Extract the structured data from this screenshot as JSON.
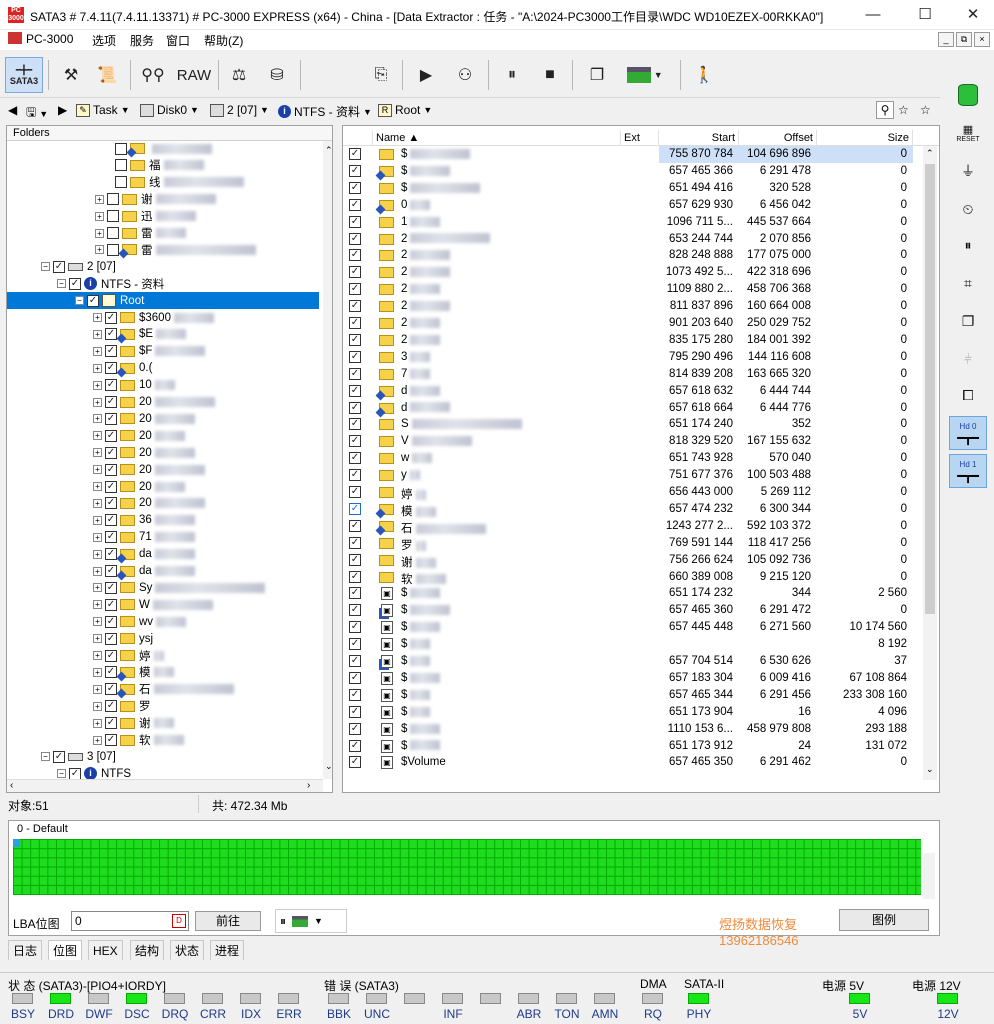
{
  "window": {
    "title": "SATA3 # 7.4.11(7.4.11.13371) # PC-3000 EXPRESS (x64) - China - [Data Extractor : 任务 - \"A:\\2024-PC3000工作目录\\WDC WD10EZEX-00RKKA0\"]",
    "minimize": "—",
    "maximize": "☐",
    "close": "✕"
  },
  "menu": {
    "items": [
      "PC-3000",
      "选项",
      "服务",
      "窗口",
      "帮助(Z)"
    ],
    "mdi": [
      "_",
      "⧉",
      "×"
    ]
  },
  "toolbar": {
    "sata_label": "SATA3",
    "raw_label": "RAW"
  },
  "nav": {
    "task": "Task",
    "disk": "Disk0",
    "partition": "2 [07]",
    "fs": "NTFS - 资料",
    "root": "Root"
  },
  "folders": {
    "header": "Folders",
    "rows": [
      {
        "label": "",
        "indent": 108,
        "blur": 60,
        "plus": false,
        "check": "",
        "type": "net"
      },
      {
        "label": "福",
        "indent": 108,
        "blur": 40,
        "plus": false,
        "check": "",
        "type": "folder"
      },
      {
        "label": "线",
        "indent": 108,
        "blur": 80,
        "plus": false,
        "check": "",
        "type": "folder"
      },
      {
        "label": "谢",
        "indent": 100,
        "blur": 60,
        "plus": true,
        "check": "",
        "type": "folder"
      },
      {
        "label": "迅",
        "indent": 100,
        "blur": 40,
        "plus": true,
        "check": "",
        "type": "folder"
      },
      {
        "label": "雷",
        "indent": 100,
        "blur": 30,
        "plus": true,
        "check": "",
        "type": "folder"
      },
      {
        "label": "雷",
        "indent": 100,
        "blur": 100,
        "plus": true,
        "check": "",
        "type": "net"
      },
      {
        "label": "2 [07]",
        "indent": 46,
        "blur": 0,
        "plus": true,
        "check": "✓",
        "type": "disk"
      },
      {
        "label": "NTFS - 资料",
        "indent": 62,
        "blur": 0,
        "plus": true,
        "check": "✓",
        "type": "info"
      },
      {
        "label": "Root",
        "indent": 80,
        "blur": 0,
        "plus": true,
        "check": "✓",
        "type": "root",
        "selected": true
      },
      {
        "label": "$3600",
        "indent": 98,
        "blur": 40,
        "plus": true,
        "check": "✓",
        "type": "folder"
      },
      {
        "label": "$E",
        "indent": 98,
        "blur": 30,
        "plus": true,
        "check": "✓",
        "type": "net"
      },
      {
        "label": "$F",
        "indent": 98,
        "blur": 50,
        "plus": true,
        "check": "✓",
        "type": "folder"
      },
      {
        "label": "0.(",
        "indent": 98,
        "blur": 0,
        "plus": true,
        "check": "✓",
        "type": "net"
      },
      {
        "label": "10",
        "indent": 98,
        "blur": 20,
        "plus": true,
        "check": "✓",
        "type": "folder"
      },
      {
        "label": "20",
        "indent": 98,
        "blur": 60,
        "plus": true,
        "check": "✓",
        "type": "folder"
      },
      {
        "label": "20",
        "indent": 98,
        "blur": 40,
        "plus": true,
        "check": "✓",
        "type": "folder"
      },
      {
        "label": "20",
        "indent": 98,
        "blur": 30,
        "plus": true,
        "check": "✓",
        "type": "folder"
      },
      {
        "label": "20",
        "indent": 98,
        "blur": 40,
        "plus": true,
        "check": "✓",
        "type": "folder"
      },
      {
        "label": "20",
        "indent": 98,
        "blur": 50,
        "plus": true,
        "check": "✓",
        "type": "folder"
      },
      {
        "label": "20",
        "indent": 98,
        "blur": 30,
        "plus": true,
        "check": "✓",
        "type": "folder"
      },
      {
        "label": "20",
        "indent": 98,
        "blur": 50,
        "plus": true,
        "check": "✓",
        "type": "folder"
      },
      {
        "label": "36",
        "indent": 98,
        "blur": 40,
        "plus": true,
        "check": "✓",
        "type": "folder"
      },
      {
        "label": "71",
        "indent": 98,
        "blur": 40,
        "plus": true,
        "check": "✓",
        "type": "folder"
      },
      {
        "label": "da",
        "indent": 98,
        "blur": 40,
        "plus": true,
        "check": "✓",
        "type": "net"
      },
      {
        "label": "da",
        "indent": 98,
        "blur": 40,
        "plus": true,
        "check": "✓",
        "type": "net"
      },
      {
        "label": "Sy",
        "indent": 98,
        "blur": 110,
        "plus": true,
        "check": "✓",
        "type": "folder"
      },
      {
        "label": "W",
        "indent": 98,
        "blur": 60,
        "plus": true,
        "check": "✓",
        "type": "folder"
      },
      {
        "label": "wv",
        "indent": 98,
        "blur": 30,
        "plus": true,
        "check": "✓",
        "type": "folder"
      },
      {
        "label": "ysj",
        "indent": 98,
        "blur": 0,
        "plus": true,
        "check": "✓",
        "type": "folder"
      },
      {
        "label": "婷",
        "indent": 98,
        "blur": 10,
        "plus": true,
        "check": "✓",
        "type": "folder"
      },
      {
        "label": "模",
        "indent": 98,
        "blur": 20,
        "plus": true,
        "check": "✓",
        "type": "net"
      },
      {
        "label": "石",
        "indent": 98,
        "blur": 80,
        "plus": true,
        "check": "✓",
        "type": "net"
      },
      {
        "label": "罗",
        "indent": 98,
        "blur": 0,
        "plus": true,
        "check": "✓",
        "type": "folder"
      },
      {
        "label": "谢",
        "indent": 98,
        "blur": 20,
        "plus": true,
        "check": "✓",
        "type": "folder"
      },
      {
        "label": "软",
        "indent": 98,
        "blur": 30,
        "plus": true,
        "check": "✓",
        "type": "folder"
      },
      {
        "label": "3 [07]",
        "indent": 46,
        "blur": 0,
        "plus": true,
        "check": "✓",
        "type": "disk"
      },
      {
        "label": "NTFS",
        "indent": 62,
        "blur": 0,
        "plus": true,
        "check": "✓",
        "type": "info"
      },
      {
        "label": "Root",
        "indent": 80,
        "blur": 0,
        "plus": true,
        "check": "✓",
        "type": "root"
      }
    ]
  },
  "files": {
    "columns": [
      "Name ▲",
      "Ext",
      "Start",
      "Offset",
      "Size"
    ],
    "rows": [
      {
        "name": "$",
        "blur": 60,
        "start": "755 870 784",
        "offset": "104 696 896",
        "size": "0",
        "type": "folder",
        "hl": true
      },
      {
        "name": "$",
        "blur": 40,
        "start": "657 465 366",
        "offset": "6 291 478",
        "size": "0",
        "type": "net"
      },
      {
        "name": "$",
        "blur": 70,
        "start": "651 494 416",
        "offset": "320 528",
        "size": "0",
        "type": "folder"
      },
      {
        "name": "0",
        "blur": 20,
        "start": "657 629 930",
        "offset": "6 456 042",
        "size": "0",
        "type": "net"
      },
      {
        "name": "1",
        "blur": 30,
        "start": "1096 711 5...",
        "offset": "445 537 664",
        "size": "0",
        "type": "folder"
      },
      {
        "name": "2",
        "blur": 80,
        "start": "653 244 744",
        "offset": "2 070 856",
        "size": "0",
        "type": "folder"
      },
      {
        "name": "2",
        "blur": 40,
        "start": "828 248 888",
        "offset": "177 075 000",
        "size": "0",
        "type": "folder"
      },
      {
        "name": "2",
        "blur": 40,
        "start": "1073 492 5...",
        "offset": "422 318 696",
        "size": "0",
        "type": "folder"
      },
      {
        "name": "2",
        "blur": 30,
        "start": "1109 880 2...",
        "offset": "458 706 368",
        "size": "0",
        "type": "folder"
      },
      {
        "name": "2",
        "blur": 40,
        "start": "811 837 896",
        "offset": "160 664 008",
        "size": "0",
        "type": "folder"
      },
      {
        "name": "2",
        "blur": 30,
        "start": "901 203 640",
        "offset": "250 029 752",
        "size": "0",
        "type": "folder"
      },
      {
        "name": "2",
        "blur": 30,
        "start": "835 175 280",
        "offset": "184 001 392",
        "size": "0",
        "type": "folder"
      },
      {
        "name": "3",
        "blur": 20,
        "start": "795 290 496",
        "offset": "144 116 608",
        "size": "0",
        "type": "folder"
      },
      {
        "name": "7",
        "blur": 20,
        "start": "814 839 208",
        "offset": "163 665 320",
        "size": "0",
        "type": "folder"
      },
      {
        "name": "d",
        "blur": 30,
        "start": "657 618 632",
        "offset": "6 444 744",
        "size": "0",
        "type": "net"
      },
      {
        "name": "d",
        "blur": 40,
        "start": "657 618 664",
        "offset": "6 444 776",
        "size": "0",
        "type": "net"
      },
      {
        "name": "S",
        "blur": 110,
        "start": "651 174 240",
        "offset": "352",
        "size": "0",
        "type": "folder"
      },
      {
        "name": "V",
        "blur": 60,
        "start": "818 329 520",
        "offset": "167 155 632",
        "size": "0",
        "type": "folder"
      },
      {
        "name": "w",
        "blur": 20,
        "start": "651 743 928",
        "offset": "570 040",
        "size": "0",
        "type": "folder"
      },
      {
        "name": "y",
        "blur": 10,
        "start": "751 677 376",
        "offset": "100 503 488",
        "size": "0",
        "type": "folder"
      },
      {
        "name": "婷",
        "blur": 10,
        "start": "656 443 000",
        "offset": "5 269 112",
        "size": "0",
        "type": "folder"
      },
      {
        "name": "模",
        "blur": 20,
        "start": "657 474 232",
        "offset": "6 300 344",
        "size": "0",
        "type": "net",
        "check": "blue"
      },
      {
        "name": "石",
        "blur": 70,
        "start": "1243 277 2...",
        "offset": "592 103 372",
        "size": "0",
        "type": "net"
      },
      {
        "name": "罗",
        "blur": 10,
        "start": "769 591 144",
        "offset": "118 417 256",
        "size": "0",
        "type": "folder"
      },
      {
        "name": "谢",
        "blur": 20,
        "start": "756 266 624",
        "offset": "105 092 736",
        "size": "0",
        "type": "folder"
      },
      {
        "name": "软",
        "blur": 30,
        "start": "660 389 008",
        "offset": "9 215 120",
        "size": "0",
        "type": "folder"
      },
      {
        "name": "$",
        "blur": 30,
        "start": "651 174 232",
        "offset": "344",
        "size": "2 560",
        "type": "file"
      },
      {
        "name": "$",
        "blur": 40,
        "start": "657 465 360",
        "offset": "6 291 472",
        "size": "0",
        "type": "netfile"
      },
      {
        "name": "$",
        "blur": 30,
        "start": "657 445 448",
        "offset": "6 271 560",
        "size": "10 174 560",
        "type": "file"
      },
      {
        "name": "$",
        "blur": 20,
        "start": "",
        "offset": "",
        "size": "8 192",
        "type": "file"
      },
      {
        "name": "$",
        "blur": 20,
        "start": "657 704 514",
        "offset": "6 530 626",
        "size": "37",
        "type": "netfile"
      },
      {
        "name": "$",
        "blur": 30,
        "start": "657 183 304",
        "offset": "6 009 416",
        "size": "67 108 864",
        "type": "file"
      },
      {
        "name": "$",
        "blur": 20,
        "start": "657 465 344",
        "offset": "6 291 456",
        "size": "233 308 160",
        "type": "file"
      },
      {
        "name": "$",
        "blur": 20,
        "start": "651 173 904",
        "offset": "16",
        "size": "4 096",
        "type": "file"
      },
      {
        "name": "$",
        "blur": 30,
        "start": "1110 153 6...",
        "offset": "458 979 808",
        "size": "293 188",
        "type": "file"
      },
      {
        "name": "$",
        "blur": 30,
        "start": "651 173 912",
        "offset": "24",
        "size": "131 072",
        "type": "file"
      },
      {
        "name": "$Volume",
        "blur": 0,
        "start": "657 465 350",
        "offset": "6 291 462",
        "size": "0",
        "type": "file"
      }
    ]
  },
  "status": {
    "objects": "对象:51",
    "total": "共:  472.34 Mb"
  },
  "bitmap": {
    "title": "0 - Default",
    "lba_label": "LBA位图",
    "lba_value": "0",
    "goto": "前往",
    "legend": "图例",
    "watermark1": "煜扬数据恢复",
    "watermark2": "13962186546"
  },
  "tabs": [
    "日志",
    "位图",
    "HEX",
    "结构",
    "状态",
    "进程"
  ],
  "panel": {
    "state_title": "状 态 (SATA3)-[PIO4+IORDY]",
    "error_title": "错 误 (SATA3)",
    "dma_title": "DMA",
    "sata_title": "SATA-II",
    "p5_title": "电源 5V",
    "p12_title": "电源 12V",
    "state_leds": [
      {
        "l": "BSY",
        "on": false
      },
      {
        "l": "DRD",
        "on": true
      },
      {
        "l": "DWF",
        "on": false
      },
      {
        "l": "DSC",
        "on": true
      },
      {
        "l": "DRQ",
        "on": false
      },
      {
        "l": "CRR",
        "on": false
      },
      {
        "l": "IDX",
        "on": false
      },
      {
        "l": "ERR",
        "on": false
      }
    ],
    "error_leds": [
      {
        "l": "BBK",
        "on": false
      },
      {
        "l": "UNC",
        "on": false
      },
      {
        "l": "",
        "on": false
      },
      {
        "l": "INF",
        "on": false
      },
      {
        "l": "",
        "on": false
      },
      {
        "l": "ABR",
        "on": false
      },
      {
        "l": "TON",
        "on": false
      },
      {
        "l": "AMN",
        "on": false
      }
    ],
    "rq": "RQ",
    "phy": "PHY",
    "v5": "5V",
    "v12": "12V"
  },
  "rightbar": {
    "reset": "RESET",
    "hd0": "Hd 0",
    "hd1": "Hd 1"
  },
  "colors": {
    "accent": "#0078d7",
    "led_on": "#19e619",
    "bitmap": "#1fdc1f"
  }
}
